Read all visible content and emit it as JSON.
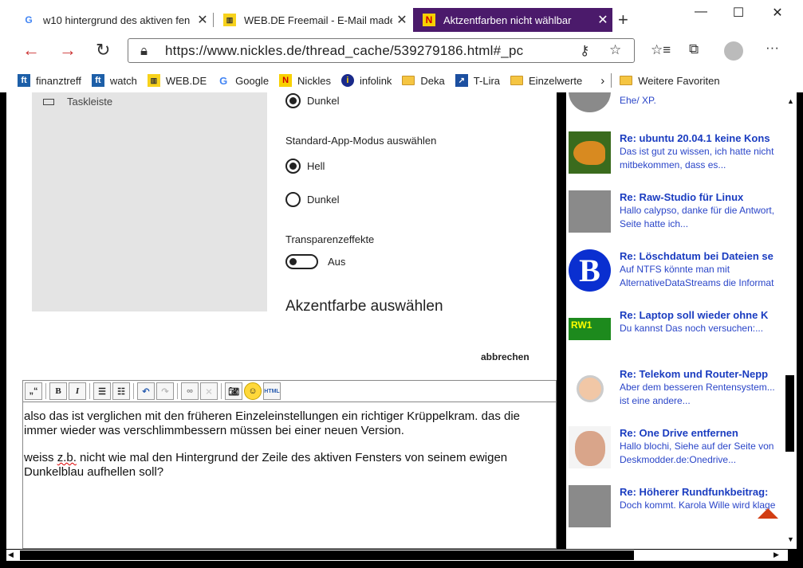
{
  "tabs": [
    {
      "title": "w10 hintergrund des aktiven fen",
      "favicon": "google-icon"
    },
    {
      "title": "WEB.DE Freemail - E-Mail made",
      "favicon": "webde-icon"
    },
    {
      "title": "Aktzentfarben nicht wählbar",
      "favicon": "nickles-icon",
      "active": true
    }
  ],
  "address": {
    "url": "https://www.nickles.de/thread_cache/539279186.html#_pc"
  },
  "bookmarks": [
    {
      "label": "finanztreff",
      "icon": "ft-icon"
    },
    {
      "label": "watch",
      "icon": "ft-icon"
    },
    {
      "label": "WEB.DE",
      "icon": "webde-icon"
    },
    {
      "label": "Google",
      "icon": "google-icon"
    },
    {
      "label": "Nickles",
      "icon": "nickles-icon"
    },
    {
      "label": "infolink",
      "icon": "info-icon"
    },
    {
      "label": "Deka",
      "icon": "folder-icon"
    },
    {
      "label": "T-Lira",
      "icon": "chart-icon"
    },
    {
      "label": "Einzelwerte",
      "icon": "folder-icon"
    },
    {
      "label": "Weitere Favoriten",
      "icon": "folder-icon"
    }
  ],
  "settings_shot": {
    "taskbar_label": "Taskleiste",
    "dark_top": "Dunkel",
    "app_mode_heading": "Standard-App-Modus auswählen",
    "option_light": "Hell",
    "option_dark": "Dunkel",
    "transparency_heading": "Transparenzeffekte",
    "transparency_state": "Aus",
    "accent_heading": "Akzentfarbe auswählen"
  },
  "cancel_label": "abbrechen",
  "editor": {
    "paragraph1": "also das ist verglichen mit den früheren Einzeleinstellungen ein richtiger Krüppelkram. das die immer wieder was verschlimmbessern müssen bei einer neuen Version.",
    "misspelled": "z.b.",
    "p2_before": "weiss ",
    "p2_after": " nicht wie mal den Hintergrund der Zeile des aktiven Fensters von seinem ewigen Dunkelblau aufhellen soll?"
  },
  "sidebar": [
    {
      "title": "",
      "snippet": "Ehe/ XP."
    },
    {
      "title": "Re: ubuntu 20.04.1 keine Kons",
      "snippet1": "Das ist gut zu wissen, ich hatte nicht",
      "snippet2": "mitbekommen, dass es..."
    },
    {
      "title": "Re: Raw-Studio für Linux",
      "snippet1": "Hallo calypso, danke für die Antwort,",
      "snippet2": "Seite hatte ich..."
    },
    {
      "title": "Re: Löschdatum bei Dateien se",
      "snippet1": "Auf NTFS könnte man mit",
      "snippet2": "AlternativeDataStreams die Informat"
    },
    {
      "title": "Re: Laptop soll wieder ohne K",
      "snippet1": "Du kannst Das noch versuchen:...",
      "snippet2": ""
    },
    {
      "title": "Re: Telekom und Router-Nepp",
      "snippet1": "Aber dem besseren Rentensystem...",
      "snippet2": "ist eine andere..."
    },
    {
      "title": "Re: One Drive entfernen",
      "snippet1": "Hallo blochi, Siehe auf der Seite von",
      "snippet2": "Deskmodder.de:Onedrive..."
    },
    {
      "title": "Re: Höherer Rundfunkbeitrag:",
      "snippet1": "Doch kommt. Karola Wille wird klage",
      "snippet2": ""
    }
  ]
}
